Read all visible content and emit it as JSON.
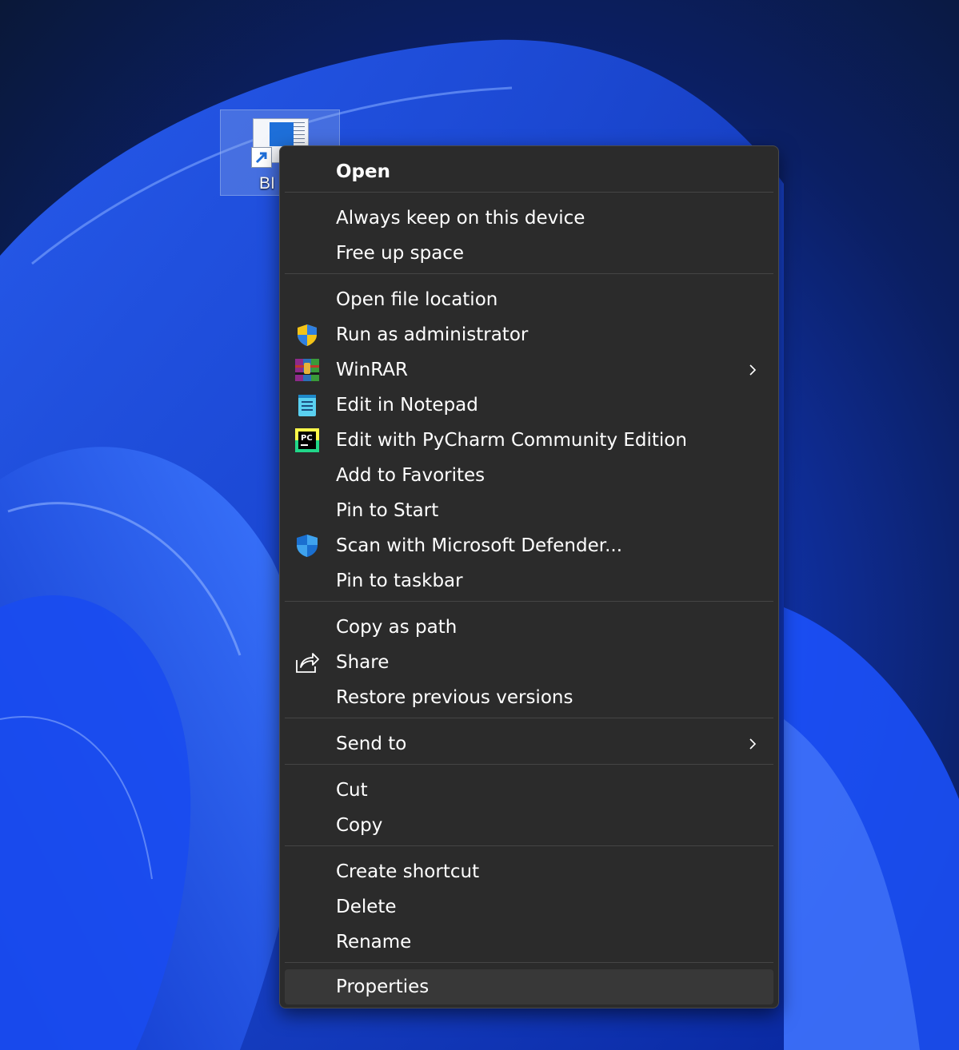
{
  "desktop": {
    "icon_label": "BI"
  },
  "context_menu": {
    "groups": [
      [
        {
          "label": "Open",
          "bold": true
        }
      ],
      [
        {
          "label": "Always keep on this device"
        },
        {
          "label": "Free up space"
        }
      ],
      [
        {
          "label": "Open file location"
        },
        {
          "label": "Run as administrator",
          "icon": "uac-shield-icon"
        },
        {
          "label": "WinRAR",
          "icon": "winrar-icon",
          "submenu": true
        },
        {
          "label": "Edit in Notepad",
          "icon": "notepad-icon"
        },
        {
          "label": "Edit with PyCharm Community Edition",
          "icon": "pycharm-icon"
        },
        {
          "label": "Add to Favorites"
        },
        {
          "label": "Pin to Start"
        },
        {
          "label": "Scan with Microsoft Defender...",
          "icon": "defender-shield-icon"
        },
        {
          "label": "Pin to taskbar"
        }
      ],
      [
        {
          "label": "Copy as path"
        },
        {
          "label": "Share",
          "icon": "share-icon"
        },
        {
          "label": "Restore previous versions"
        }
      ],
      [
        {
          "label": "Send to",
          "submenu": true
        }
      ],
      [
        {
          "label": "Cut"
        },
        {
          "label": "Copy"
        }
      ],
      [
        {
          "label": "Create shortcut"
        },
        {
          "label": "Delete"
        },
        {
          "label": "Rename"
        }
      ],
      [
        {
          "label": "Properties",
          "hover": true
        }
      ]
    ]
  },
  "icons": {
    "pycharm_letters": "PC"
  },
  "colors": {
    "menu_bg": "#2b2b2b",
    "hover_bg": "#383838",
    "separator": "#454545",
    "text": "#ffffff"
  }
}
